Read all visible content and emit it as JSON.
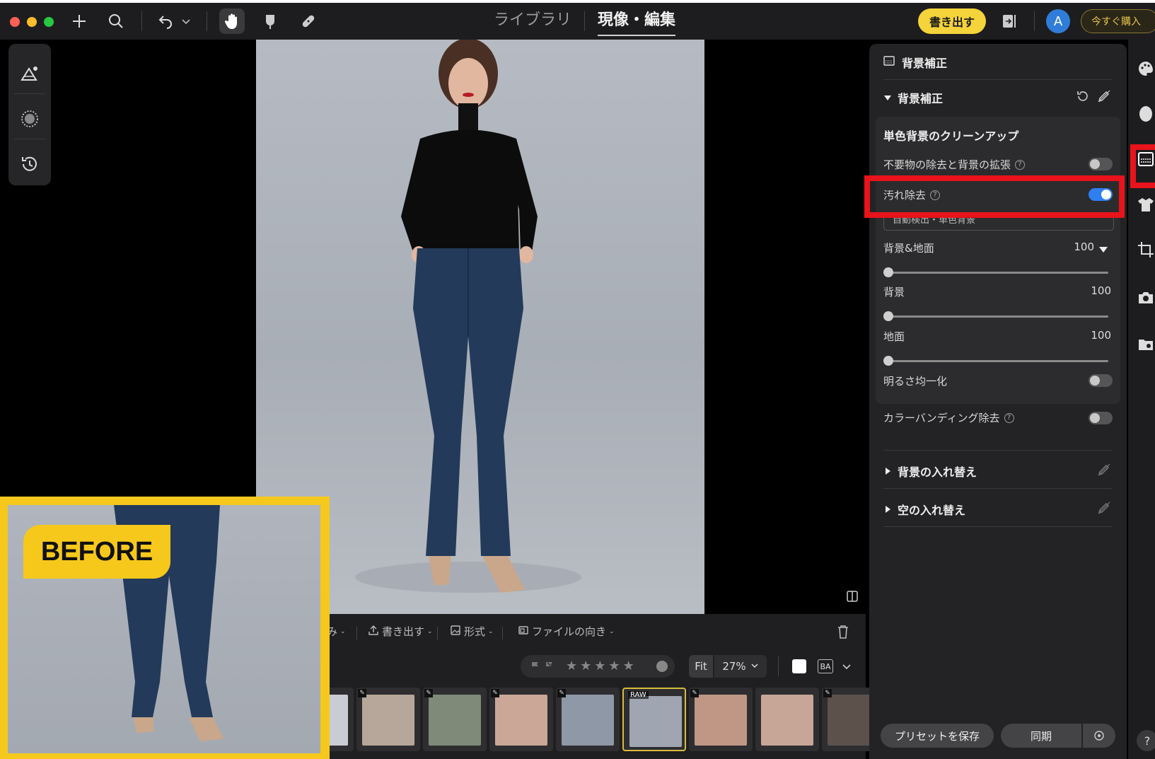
{
  "topbar": {
    "tabs": [
      {
        "label": "ライブラリ",
        "active": false
      },
      {
        "label": "現像・編集",
        "active": true
      }
    ],
    "export_label": "書き出す",
    "avatar_letter": "A",
    "buy_label": "今すぐ購入",
    "icons": [
      "plus-icon",
      "search-icon",
      "undo-icon",
      "chevron-down-icon",
      "hand-icon",
      "brush-icon",
      "bandage-icon",
      "compare-panel-icon"
    ]
  },
  "left_tools": [
    "landscape-adjust-icon",
    "texture-circle-icon",
    "history-icon"
  ],
  "before_label": "BEFORE",
  "bottom": {
    "menu_items": [
      "み",
      "書き出す",
      "形式",
      "ファイルの向き"
    ],
    "fit_label": "Fit",
    "zoom": "27%",
    "ba_label": "BA",
    "thumbnails": [
      {
        "color": "#c9ccd2",
        "edited": false,
        "raw": false,
        "selected": false
      },
      {
        "color": "#b7a79a",
        "edited": true,
        "raw": false,
        "selected": false
      },
      {
        "color": "#7f8a78",
        "edited": true,
        "raw": false,
        "selected": false
      },
      {
        "color": "#caa797",
        "edited": true,
        "raw": false,
        "selected": false
      },
      {
        "color": "#8e98a6",
        "edited": true,
        "raw": false,
        "selected": false
      },
      {
        "color": "#9fa6b1",
        "edited": false,
        "raw": true,
        "selected": true
      },
      {
        "color": "#c09785",
        "edited": true,
        "raw": false,
        "selected": false
      },
      {
        "color": "#c7a698",
        "edited": false,
        "raw": false,
        "selected": false
      },
      {
        "color": "#5d514c",
        "edited": true,
        "raw": false,
        "selected": false
      }
    ],
    "raw_label": "RAW"
  },
  "panel": {
    "title": "背景補正",
    "section_title": "背景補正",
    "group_title": "単色背景のクリーンアップ",
    "rows": {
      "remove_expand": {
        "label": "不要物の除去と背景の拡張",
        "on": false
      },
      "stain_removal": {
        "label": "汚れ除去",
        "on": true
      },
      "dropdown_value": "自動検出・単色背景",
      "bg_ground": {
        "label": "背景&地面",
        "value": 100
      },
      "background": {
        "label": "背景",
        "value": 100
      },
      "ground": {
        "label": "地面",
        "value": 100
      },
      "brightness_even": {
        "label": "明るさ均一化",
        "on": false
      },
      "color_banding": {
        "label": "カラーバンディング除去",
        "on": false
      }
    },
    "bg_replace": "背景の入れ替え",
    "sky_replace": "空の入れ替え",
    "save_preset": "プリセットを保存",
    "sync": "同期"
  },
  "right_strip": [
    "palette-icon",
    "face-icon",
    "background-icon",
    "shirt-icon",
    "crop-icon",
    "camera-icon",
    "folder-icon",
    "help-icon"
  ],
  "colors": {
    "accent_yellow": "#f5d33a",
    "highlight_red": "#e8131b",
    "toggle_blue": "#2f7ff0"
  }
}
